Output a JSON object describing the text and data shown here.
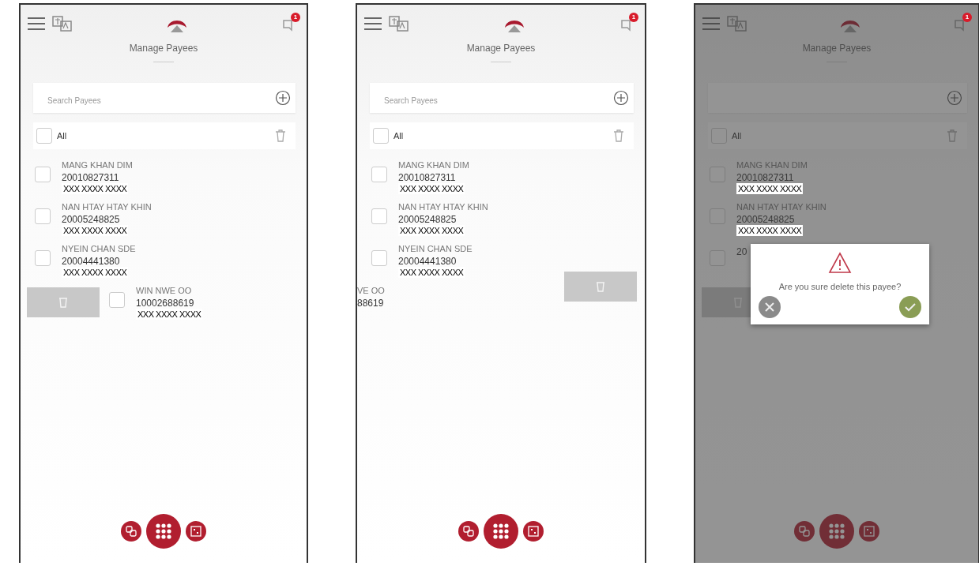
{
  "screens": [
    {
      "dimmed": false,
      "badge": "1",
      "title": "Manage Payees",
      "search": {
        "placeholder": "Search Payees"
      },
      "select_all": {
        "label": "All",
        "checked": false
      },
      "payees": [
        {
          "kind": "plain",
          "name": "MANG KHAN DIM",
          "account": "20010827311",
          "mask": "XXX XXXX XXXX",
          "checked": false
        },
        {
          "kind": "plain",
          "name": "NAN HTAY HTAY KHIN",
          "account": "20005248825",
          "mask": "XXX XXXX XXXX",
          "checked": false
        },
        {
          "kind": "plain",
          "name": "NYEIN CHAN SDE",
          "account": "20004441380",
          "mask": "XXX XXXX XXXX",
          "checked": false
        },
        {
          "kind": "swiped_right",
          "name": "WIN NWE OO",
          "account": "10002688619",
          "mask": "XXX XXXX XXXX",
          "checked": false
        }
      ]
    },
    {
      "dimmed": false,
      "badge": "1",
      "title": "Manage Payees",
      "search": {
        "placeholder": "Search Payees"
      },
      "select_all": {
        "label": "All",
        "checked": false
      },
      "payees": [
        {
          "kind": "plain",
          "name": "MANG KHAN DIM",
          "account": "20010827311",
          "mask": "XXX XXXX XXXX",
          "checked": false
        },
        {
          "kind": "plain",
          "name": "NAN HTAY HTAY KHIN",
          "account": "20005248825",
          "mask": "XXX XXXX XXXX",
          "checked": false
        },
        {
          "kind": "plain",
          "name": "NYEIN CHAN SDE",
          "account": "20004441380",
          "mask": "XXX XXXX XXXX",
          "checked": false
        },
        {
          "kind": "swiped_left",
          "name": "VE OO",
          "account": "88619"
        }
      ]
    },
    {
      "dimmed": true,
      "badge": "1",
      "title": "Manage Payees",
      "select_all": {
        "label": "All",
        "checked": false
      },
      "payees": [
        {
          "kind": "plain",
          "name": "MANG KHAN DIM",
          "account": "20010827311",
          "mask": "XXX XXXX XXXX",
          "checked": false
        },
        {
          "kind": "plain",
          "name": "NAN HTAY HTAY KHIN",
          "account": "20005248825",
          "mask": "XXX XXXX XXXX",
          "checked": false
        },
        {
          "kind": "plain",
          "account": "20",
          "checked": false
        },
        {
          "kind": "swiped_right"
        }
      ],
      "dialog": {
        "message": "Are you sure delete this payee?"
      }
    }
  ]
}
